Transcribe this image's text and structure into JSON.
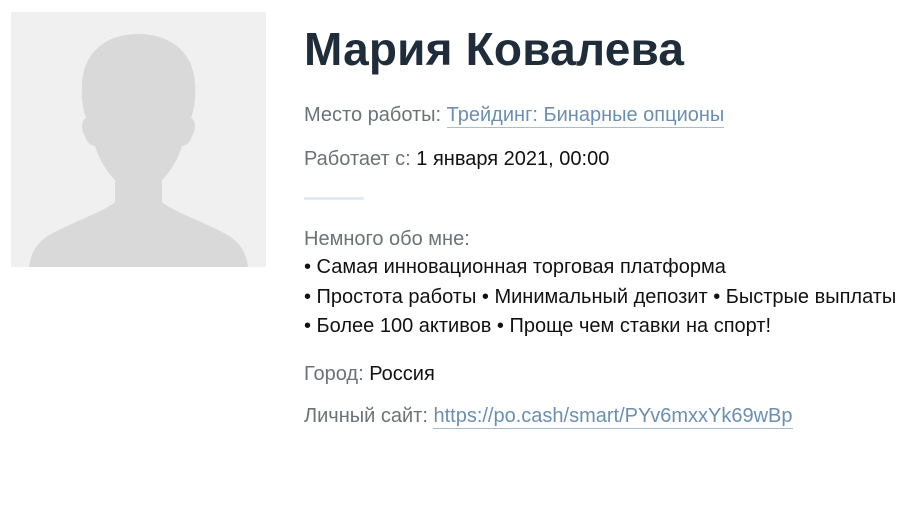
{
  "profile": {
    "name": "Мария Ковалева",
    "work_label": "Место работы:",
    "work_value": "Трейдинг: Бинарные опционы",
    "since_label": "Работает с:",
    "since_value": "1 января 2021, 00:00",
    "about_label": "Немного обо мне:",
    "about_lines": [
      "• Самая инновационная торговая платформа",
      "• Простота работы • Минимальный депозит • Быстрые выплаты",
      "• Более 100 активов • Проще чем ставки на спорт!"
    ],
    "city_label": "Город:",
    "city_value": "Россия",
    "site_label": "Личный сайт:",
    "site_value": "https://po.cash/smart/PYv6mxxYk69wBp"
  },
  "icons": {
    "avatar": "person-silhouette-icon"
  },
  "colors": {
    "name": "#1f2d3a",
    "label": "#6b7278",
    "link": "#6b8fb0",
    "avatar_bg": "#f0f0f0",
    "silhouette": "#d9d9d9",
    "divider": "#e3ebf3"
  }
}
